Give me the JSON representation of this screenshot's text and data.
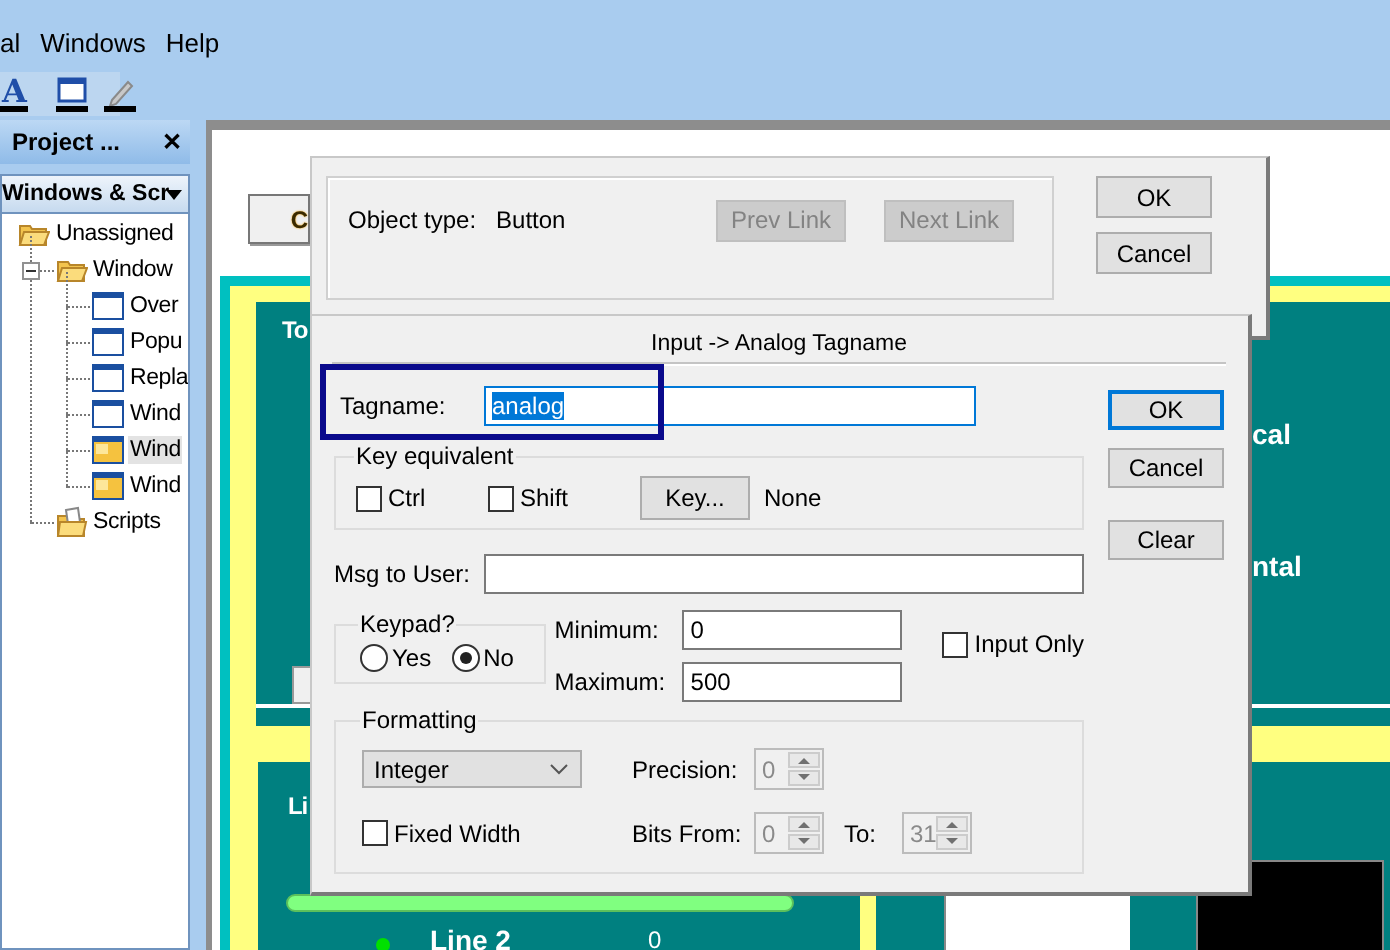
{
  "menu": [
    {
      "label": "al"
    },
    {
      "label": "Windows"
    },
    {
      "label": "Help"
    }
  ],
  "toolbar": [
    {
      "kind": "text",
      "glyph": "A"
    },
    {
      "kind": "window"
    },
    {
      "kind": "pen"
    }
  ],
  "project_panel": {
    "title": "Project ...",
    "close": "✕",
    "view": "Windows & Scr",
    "tree": [
      {
        "label": "Unassigned",
        "kind": "folder",
        "selected": false,
        "children": [
          {
            "label": "Window",
            "kind": "folder",
            "selected": false,
            "expanded": true,
            "children": [
              {
                "label": "Over",
                "kind": "window",
                "selected": false
              },
              {
                "label": "Popu",
                "kind": "window",
                "selected": false
              },
              {
                "label": "Repla",
                "kind": "window",
                "selected": false
              },
              {
                "label": "Wind",
                "kind": "window",
                "selected": false
              },
              {
                "label": "Wind",
                "kind": "active-window",
                "selected": true
              },
              {
                "label": "Wind",
                "kind": "active-window",
                "selected": false
              }
            ]
          },
          {
            "label": "Scripts",
            "kind": "scripts",
            "selected": false
          }
        ]
      }
    ]
  },
  "canvas": {
    "button_label": "C",
    "labels": [
      "To",
      "Li",
      "cal",
      "ntal",
      "Line 2",
      "0"
    ]
  },
  "link_dialog": {
    "object_type_label": "Object type:",
    "object_type": "Button",
    "links": [
      {
        "label": "Prev Link",
        "disabled": true
      },
      {
        "label": "Next Link",
        "disabled": true
      }
    ],
    "buttons": [
      {
        "label": "OK"
      },
      {
        "label": "Cancel"
      }
    ]
  },
  "input_dialog": {
    "title": "Input -> Analog Tagname",
    "tagname": {
      "label": "Tagname:",
      "value": "analog",
      "value_selected": true,
      "highlighted": true
    },
    "key_equivalent": {
      "title": "Key equivalent",
      "modifiers": [
        {
          "label": "Ctrl",
          "checked": false
        },
        {
          "label": "Shift",
          "checked": false
        }
      ],
      "key_button": "Key...",
      "key": "None"
    },
    "message": {
      "label": "Msg to User:"
    },
    "keypad": {
      "title": "Keypad?",
      "options": [
        {
          "label": "Yes",
          "selected": false
        },
        {
          "label": "No",
          "selected": true
        }
      ]
    },
    "minimum": {
      "label": "Minimum:",
      "value": "0"
    },
    "maximum": {
      "label": "Maximum:",
      "value": "500"
    },
    "input_only": {
      "label": "Input Only",
      "checked": false
    },
    "formatting": {
      "title": "Formatting",
      "format": "Integer",
      "fixed_width": {
        "label": "Fixed Width",
        "checked": false
      },
      "precision": {
        "label": "Precision:",
        "value": "0",
        "disabled": true
      },
      "bits_from": {
        "label": "Bits From:",
        "value": "0",
        "disabled": true
      },
      "bits_to": {
        "label": "To:",
        "value": "31",
        "disabled": true
      }
    },
    "buttons": [
      {
        "label": "OK",
        "default": true
      },
      {
        "label": "Cancel",
        "default": false
      },
      {
        "label": "Clear",
        "default": false
      }
    ]
  }
}
